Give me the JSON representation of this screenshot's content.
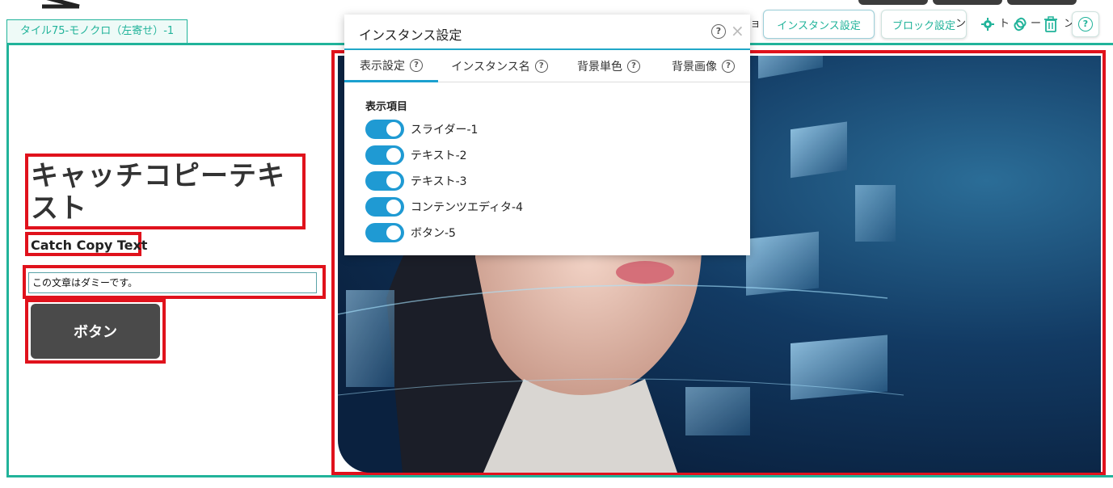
{
  "instance_tab": {
    "label": "タイル75-モノクロ（左寄せ）-1"
  },
  "toolbar": {
    "instance_settings": "インスタンス設定",
    "block_settings": "ブロック設定",
    "fragment_1": "ョ",
    "fragment_2": "ン",
    "fragment_3": "ト",
    "fragment_4": "ー",
    "fragment_5": "ン",
    "icons": [
      "gear-icon",
      "copy-icon",
      "trash-icon",
      "help-icon"
    ]
  },
  "content": {
    "catch_title": "キャッチコピーテキスト",
    "catch_sub": "Catch Copy Text",
    "dummy_text": "この文章はダミーです。",
    "button_label": "ボタン"
  },
  "popup": {
    "title": "インスタンス設定",
    "help": "?",
    "close": "×",
    "tabs": [
      {
        "label": "表示設定",
        "active": true
      },
      {
        "label": "インスタンス名",
        "active": false
      },
      {
        "label": "背景単色",
        "active": false
      },
      {
        "label": "背景画像",
        "active": false
      }
    ],
    "section_label": "表示項目",
    "toggles": [
      {
        "label": "スライダー-1",
        "on": true
      },
      {
        "label": "テキスト-2",
        "on": true
      },
      {
        "label": "テキスト-3",
        "on": true
      },
      {
        "label": "コンテンツエディタ-4",
        "on": true
      },
      {
        "label": "ボタン-5",
        "on": true
      }
    ]
  },
  "colors": {
    "accent_green": "#21b39a",
    "highlight_red": "#e0121c",
    "toggle_blue": "#1f9ad3",
    "button_dark": "#4a4a4a"
  }
}
